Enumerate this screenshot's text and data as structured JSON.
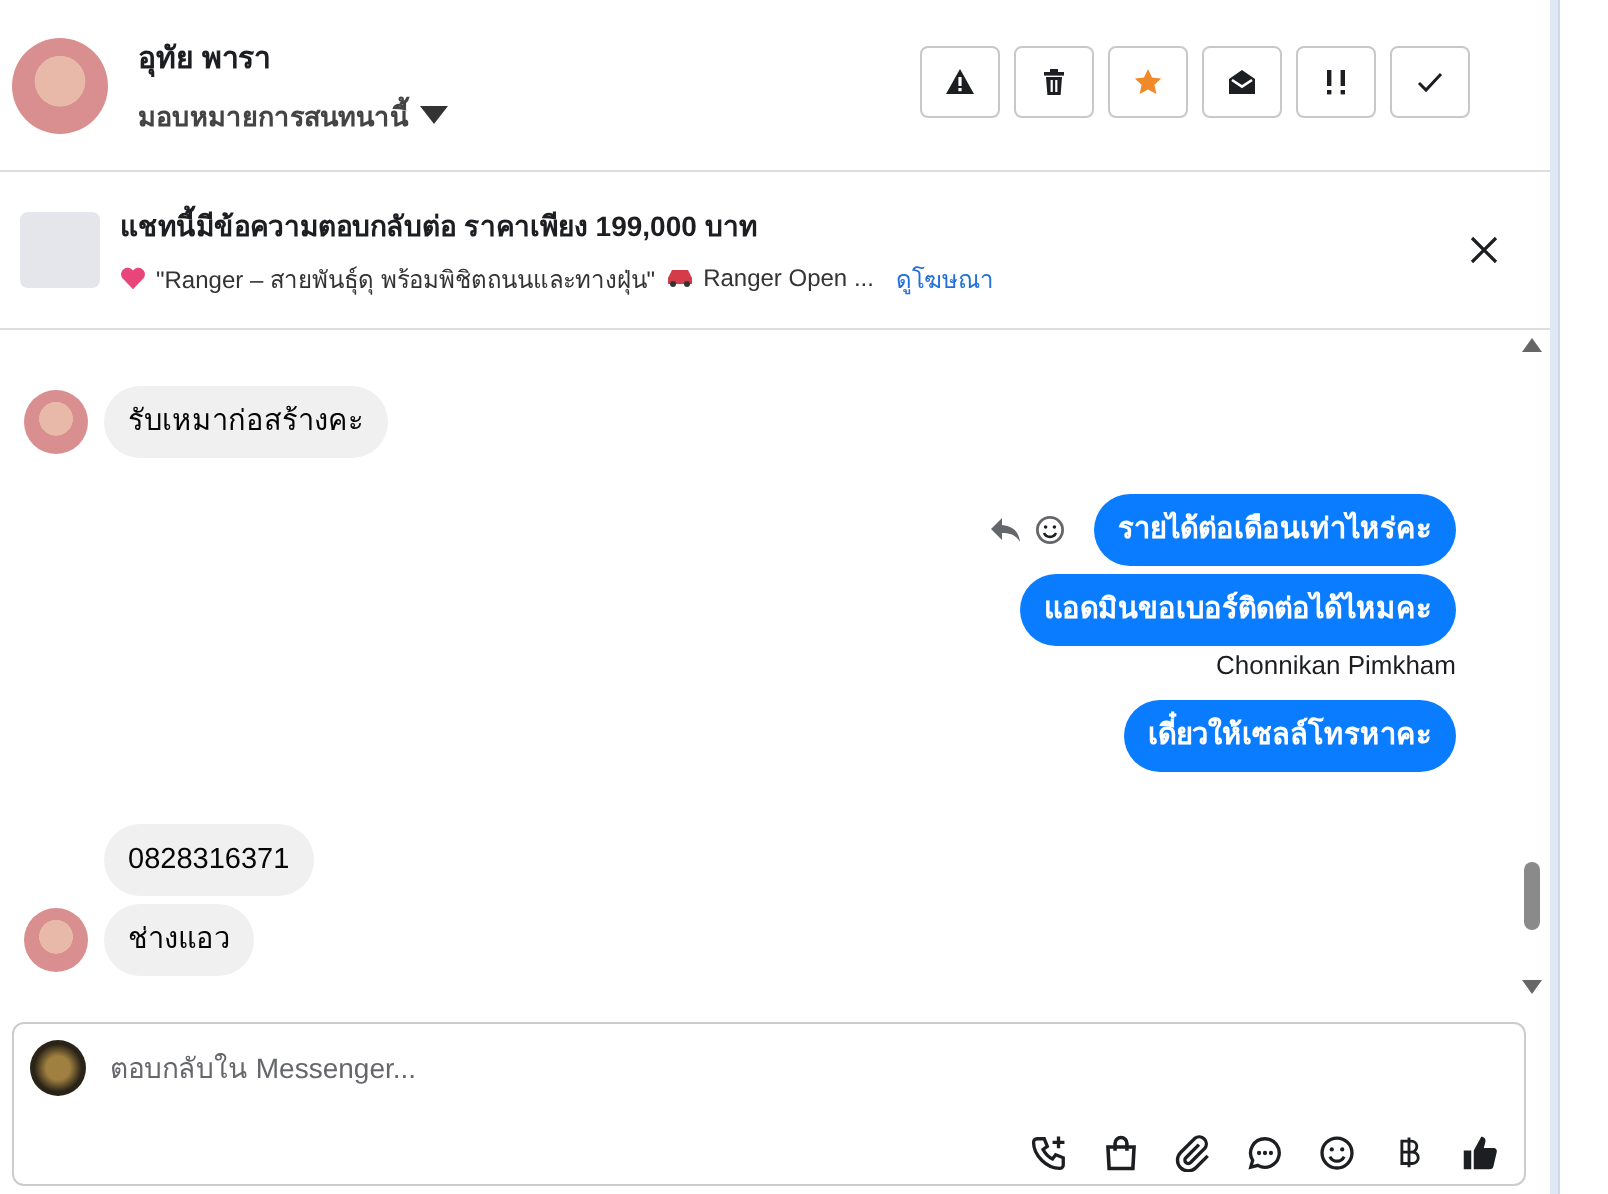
{
  "contact": {
    "name": "อุทัย พารา",
    "assign_label": "มอบหมายการสนทนานี้"
  },
  "actions": [
    {
      "kind": "warning",
      "on": false
    },
    {
      "kind": "trash",
      "on": false
    },
    {
      "kind": "star",
      "on": true
    },
    {
      "kind": "envelope",
      "on": false
    },
    {
      "kind": "exclaim",
      "on": false
    },
    {
      "kind": "check",
      "on": false
    }
  ],
  "ad": {
    "title": "แชทนี้มีข้อความตอบกลับต่อ ราคาเพียง 199,000 บาท",
    "quote": "\"Ranger – สายพันธุ์ดุ พร้อมพิชิตถนนและทางฝุ่น\"",
    "product": "Ranger Open ...",
    "link": "ดูโฆษณา"
  },
  "messages": [
    {
      "kind": "incoming",
      "text": "รับเหมาก่อสร้างคะ",
      "avatar": true
    },
    {
      "kind": "outgoing",
      "text": "รายได้ต่อเดือนเท่าไหร่คะ",
      "actions": true
    },
    {
      "kind": "outgoing",
      "text": "แอดมินขอเบอร์ติดต่อได้ไหมคะ",
      "actions": false
    },
    {
      "kind": "sender",
      "text": "Chonnikan Pimkham"
    },
    {
      "kind": "outgoing",
      "text": "เดี๋ยวให้เซลล์โทรหาคะ",
      "actions": false
    },
    {
      "kind": "incoming",
      "text": "0828316371",
      "avatar": false
    },
    {
      "kind": "incoming",
      "text": "ช่างแอว",
      "avatar": true
    }
  ],
  "composer": {
    "placeholder": "ตอบกลับใน Messenger...",
    "tools": [
      {
        "kind": "call"
      },
      {
        "kind": "bag"
      },
      {
        "kind": "clip"
      },
      {
        "kind": "bubble"
      },
      {
        "kind": "smile"
      },
      {
        "kind": "baht"
      },
      {
        "kind": "like"
      }
    ]
  }
}
